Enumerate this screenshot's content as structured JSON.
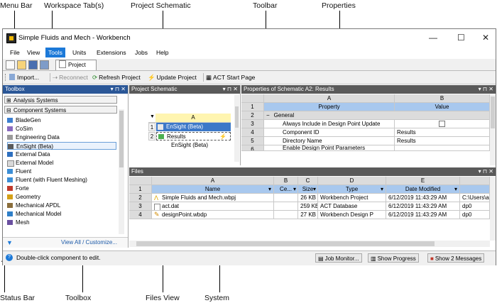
{
  "callouts": {
    "menu_bar": "Menu Bar",
    "workspace_tabs": "Workspace Tab(s)",
    "project_schematic": "Project Schematic",
    "toolbar": "Toolbar",
    "properties": "Properties",
    "status_bar": "Status Bar",
    "toolbox": "Toolbox",
    "files_view": "Files View",
    "system": "System"
  },
  "window": {
    "title": "Simple Fluids and Mech - Workbench",
    "minimize": "—",
    "maximize": "☐",
    "close": "✕"
  },
  "menu": [
    "File",
    "View",
    "Tools",
    "Units",
    "Extensions",
    "Jobs",
    "Help"
  ],
  "active_menu": "Tools",
  "tabs": {
    "project": "Project"
  },
  "toolbar": {
    "import": "Import...",
    "reconnect": "Reconnect",
    "refresh": "Refresh Project",
    "update": "Update Project",
    "act_start": "ACT Start Page"
  },
  "toolbox": {
    "title": "Toolbox",
    "groups": {
      "analysis": "Analysis Systems",
      "component": "Component Systems"
    },
    "items": [
      "BladeGen",
      "CoSim",
      "Engineering Data",
      "EnSight (Beta)",
      "External Data",
      "External Model",
      "Fluent",
      "Fluent (with Fluent Meshing)",
      "Forte",
      "Geometry",
      "Mechanical APDL",
      "Mechanical Model",
      "Mesh"
    ],
    "selected": "EnSight (Beta)",
    "footer_link": "View All / Customize..."
  },
  "schematic": {
    "title": "Project Schematic",
    "system": {
      "col": "A",
      "rows": [
        {
          "num": "1",
          "label": "EnSight (Beta)"
        },
        {
          "num": "2",
          "label": "Results"
        }
      ],
      "caption": "EnSight (Beta)"
    }
  },
  "properties": {
    "title": "Properties of Schematic A2: Results",
    "cols": [
      "A",
      "B"
    ],
    "header": [
      "Property",
      "Value"
    ],
    "rows": [
      {
        "num": "1",
        "property": "Property",
        "value": "Value"
      },
      {
        "num": "2",
        "property": "General",
        "value": ""
      },
      {
        "num": "3",
        "property": "Always Include in Design Point Update",
        "value": ""
      },
      {
        "num": "4",
        "property": "Component ID",
        "value": "Results"
      },
      {
        "num": "5",
        "property": "Directory Name",
        "value": "Results"
      },
      {
        "num": "6",
        "property": "Enable Design Point Parameters",
        "value": ""
      }
    ],
    "section_toggle": "−"
  },
  "files": {
    "title": "Files",
    "cols": [
      "A",
      "B",
      "C",
      "D",
      "E"
    ],
    "header": [
      "Name",
      "Ce...",
      "Size",
      "Type",
      "Date Modified"
    ],
    "rows": [
      {
        "num": "2",
        "name": "Simple Fluids and Mech.wbpj",
        "size": "26 KB",
        "type": "Workbench Project",
        "date": "6/12/2019 11:43:29 AM",
        "loc": "C:\\Users\\ah"
      },
      {
        "num": "3",
        "name": "act.dat",
        "size": "259 KB",
        "type": "ACT Database",
        "date": "6/12/2019 11:43:29 AM",
        "loc": "dp0"
      },
      {
        "num": "4",
        "name": "designPoint.wbdp",
        "size": "27 KB",
        "type": "Workbench Design P",
        "date": "6/12/2019 11:43:29 AM",
        "loc": "dp0"
      }
    ]
  },
  "status": {
    "text": "Double-click component to edit.",
    "job_monitor": "Job Monitor...",
    "show_progress": "Show Progress",
    "messages": "Show 2 Messages"
  },
  "colors": {
    "accent": "#1c79d8",
    "panel_header": "#5a5a5a",
    "column_header": "#a8c8ee"
  }
}
